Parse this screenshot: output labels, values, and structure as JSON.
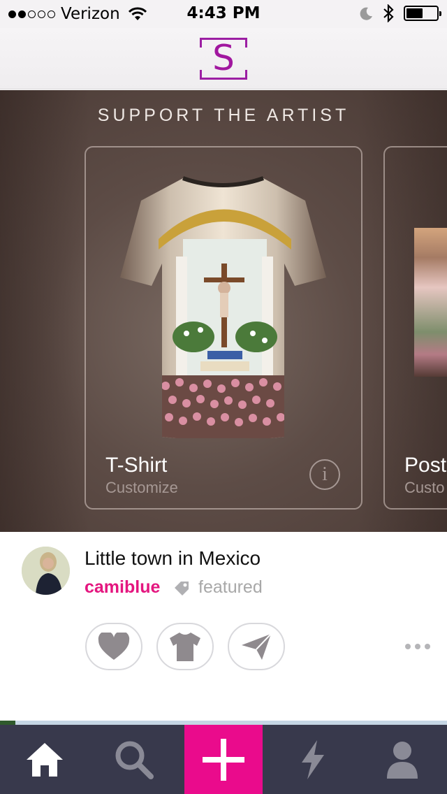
{
  "status_bar": {
    "carrier": "Verizon",
    "signal_dots_filled": 2,
    "signal_dots_total": 5,
    "time": "4:43 PM",
    "battery_level": 0.55
  },
  "header": {
    "logo_letter": "S",
    "brand_color": "#a1179f"
  },
  "carousel": {
    "title": "SUPPORT THE ARTIST",
    "cards": [
      {
        "name": "T-Shirt",
        "subtitle": "Customize",
        "info_icon": "info-icon"
      },
      {
        "name": "Post",
        "subtitle": "Custo"
      }
    ]
  },
  "post": {
    "title": "Little town in Mexico",
    "username": "camiblue",
    "tag": "featured",
    "username_color": "#e4167f",
    "actions": [
      "heart-icon",
      "tshirt-icon",
      "send-icon"
    ],
    "more_icon": "more-icon"
  },
  "tabbar": {
    "tabs": [
      "home-icon",
      "search-icon",
      "add-icon",
      "activity-icon",
      "profile-icon"
    ],
    "active_color": "#ea0b8c",
    "background": "#38394c"
  }
}
